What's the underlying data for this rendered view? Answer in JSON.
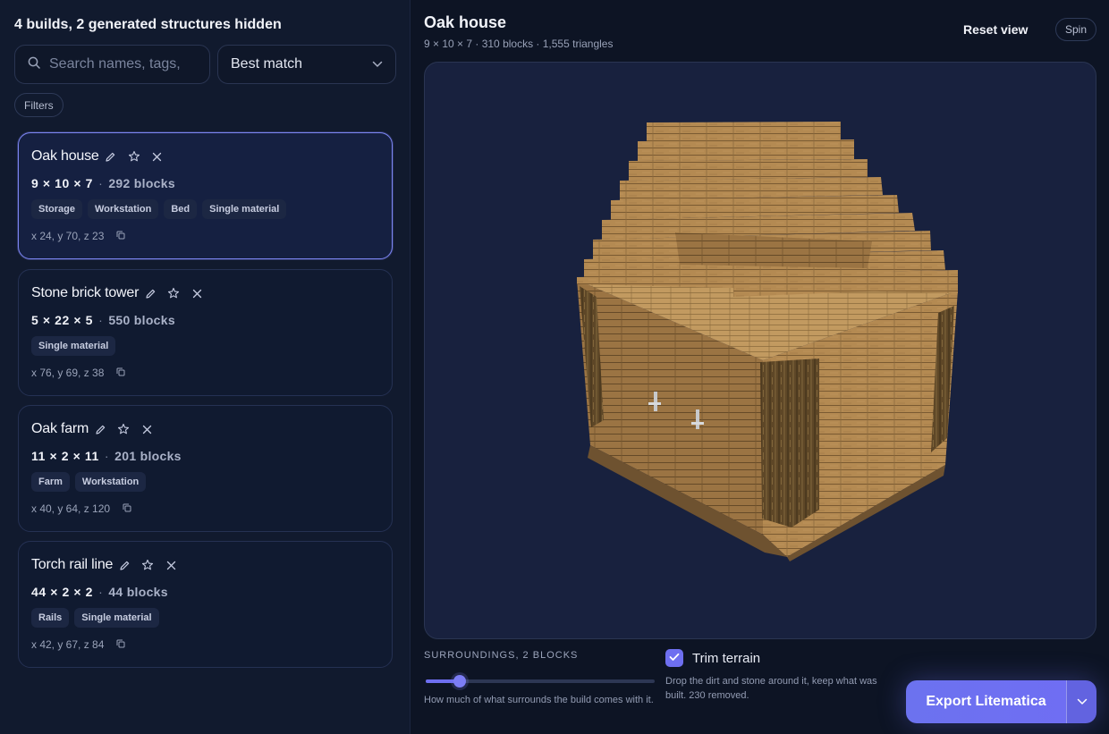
{
  "sidebar": {
    "summary": "4 builds, 2 generated structures hidden",
    "search_placeholder": "Search names, tags,",
    "sort_value": "Best match",
    "filters_label": "Filters",
    "builds": [
      {
        "name": "Oak house",
        "dims": "9 × 10 × 7",
        "blocks": "292 blocks",
        "tags": [
          "Storage",
          "Workstation",
          "Bed",
          "Single material"
        ],
        "coords": "x 24, y 70, z 23",
        "selected": true
      },
      {
        "name": "Stone brick tower",
        "dims": "5 × 22 × 5",
        "blocks": "550 blocks",
        "tags": [
          "Single material"
        ],
        "coords": "x 76, y 69, z 38",
        "selected": false
      },
      {
        "name": "Oak farm",
        "dims": "11 × 2 × 11",
        "blocks": "201 blocks",
        "tags": [
          "Farm",
          "Workstation"
        ],
        "coords": "x 40, y 64, z 120",
        "selected": false
      },
      {
        "name": "Torch rail line",
        "dims": "44 × 2 × 2",
        "blocks": "44 blocks",
        "tags": [
          "Rails",
          "Single material"
        ],
        "coords": "x 42, y 67, z 84",
        "selected": false
      }
    ]
  },
  "viewer": {
    "title": "Oak house",
    "subtitle": "9 × 10 × 7 · 310 blocks · 1,555 triangles",
    "reset_label": "Reset view",
    "spin_label": "Spin"
  },
  "controls": {
    "surroundings_label": "SURROUNDINGS, 2 BLOCKS",
    "surroundings_fraction": 0.15,
    "surroundings_help": "How much of what surrounds the build comes with it.",
    "trim_label": "Trim terrain",
    "trim_checked": true,
    "trim_help": "Drop the dirt and stone around it, keep what was built. 230 removed.",
    "export_label": "Export Litematica"
  },
  "icons": {
    "search": "search-icon",
    "sort": "chevron-down-icon",
    "edit": "pencil-icon",
    "favorite": "star-icon",
    "remove": "close-icon",
    "copy": "copy-icon",
    "check": "check-icon",
    "export_menu": "chevron-down-icon"
  },
  "colors": {
    "accent": "#6e6ff0",
    "background": "#0d1424",
    "panel": "#111a2e",
    "wood": "#b48a52",
    "log": "#6b5230"
  }
}
